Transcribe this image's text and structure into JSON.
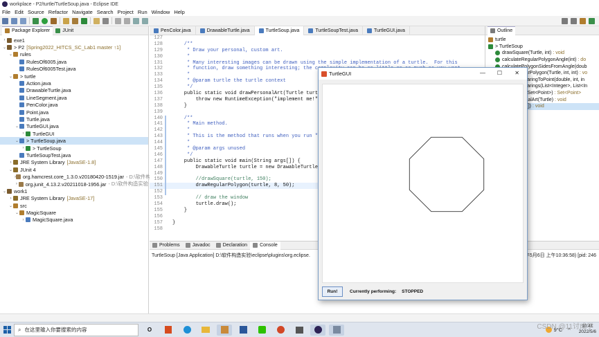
{
  "titlebar": {
    "title": "workplace - P2/turtle/TurtleSoup.java - Eclipse IDE"
  },
  "menu": [
    "File",
    "Edit",
    "Source",
    "Refactor",
    "Navigate",
    "Search",
    "Project",
    "Run",
    "Window",
    "Help"
  ],
  "explorer": {
    "tabs": [
      "Package Explorer",
      "JUnit"
    ],
    "rows": [
      {
        "indent": 0,
        "twisty": "›",
        "icon": "project-icon",
        "color": "#7a5b2e",
        "label": "exe1",
        "dec": "",
        "gray": ""
      },
      {
        "indent": 0,
        "twisty": "⌄",
        "icon": "project-icon",
        "color": "#7a5b2e",
        "label": "> P2",
        "dec": "[Spring2022_HITCS_SC_Lab1 master ↑1]",
        "gray": ""
      },
      {
        "indent": 1,
        "twisty": "⌄",
        "icon": "package-icon",
        "color": "#b07d2e",
        "label": "rules",
        "dec": "",
        "gray": ""
      },
      {
        "indent": 2,
        "twisty": "",
        "icon": "java-file-icon",
        "color": "#4a7bbd",
        "label": "RulesOf6005.java",
        "dec": "",
        "gray": ""
      },
      {
        "indent": 2,
        "twisty": "",
        "icon": "java-file-icon",
        "color": "#4a7bbd",
        "label": "RulesOf6005Test.java",
        "dec": "",
        "gray": ""
      },
      {
        "indent": 1,
        "twisty": "⌄",
        "icon": "package-icon",
        "color": "#b07d2e",
        "label": "> turtle",
        "dec": "",
        "gray": ""
      },
      {
        "indent": 2,
        "twisty": "",
        "icon": "java-file-icon",
        "color": "#4a7bbd",
        "label": "Action.java",
        "dec": "",
        "gray": ""
      },
      {
        "indent": 2,
        "twisty": "",
        "icon": "java-file-icon",
        "color": "#4a7bbd",
        "label": "DrawableTurtle.java",
        "dec": "",
        "gray": ""
      },
      {
        "indent": 2,
        "twisty": "",
        "icon": "java-file-icon",
        "color": "#4a7bbd",
        "label": "LineSegment.java",
        "dec": "",
        "gray": ""
      },
      {
        "indent": 2,
        "twisty": "",
        "icon": "java-file-icon",
        "color": "#4a7bbd",
        "label": "PenColor.java",
        "dec": "",
        "gray": ""
      },
      {
        "indent": 2,
        "twisty": "",
        "icon": "java-file-icon",
        "color": "#4a7bbd",
        "label": "Point.java",
        "dec": "",
        "gray": ""
      },
      {
        "indent": 2,
        "twisty": "",
        "icon": "java-file-icon",
        "color": "#4a7bbd",
        "label": "Turtle.java",
        "dec": "",
        "gray": ""
      },
      {
        "indent": 2,
        "twisty": "⌄",
        "icon": "java-file-icon",
        "color": "#4a7bbd",
        "label": "TurtleGUI.java",
        "dec": "",
        "gray": ""
      },
      {
        "indent": 3,
        "twisty": "›",
        "icon": "class-icon",
        "color": "#2d8a3b",
        "label": "TurtleGUI",
        "dec": "",
        "gray": ""
      },
      {
        "indent": 2,
        "twisty": "⌄",
        "icon": "java-file-icon",
        "color": "#4a7bbd",
        "label": "> TurtleSoup.java",
        "dec": "",
        "gray": "",
        "selected": true
      },
      {
        "indent": 3,
        "twisty": "›",
        "icon": "class-icon",
        "color": "#2d8a3b",
        "label": "> TurtleSoup",
        "dec": "",
        "gray": ""
      },
      {
        "indent": 2,
        "twisty": "",
        "icon": "java-file-icon",
        "color": "#4a7bbd",
        "label": "TurtleSoupTest.java",
        "dec": "",
        "gray": ""
      },
      {
        "indent": 1,
        "twisty": "›",
        "icon": "library-icon",
        "color": "#8a6d2a",
        "label": "JRE System Library",
        "dec": "[JavaSE-1.8]",
        "gray": ""
      },
      {
        "indent": 1,
        "twisty": "⌄",
        "icon": "library-icon",
        "color": "#8a6d2a",
        "label": "JUnit 4",
        "dec": "",
        "gray": ""
      },
      {
        "indent": 2,
        "twisty": "›",
        "icon": "jar-icon",
        "color": "#9a7a4a",
        "label": "org.hamcrest.core_1.3.0.v20180420-1519.jar",
        "dec": "",
        "gray": "- D:\\软件构"
      },
      {
        "indent": 2,
        "twisty": "›",
        "icon": "jar-icon",
        "color": "#9a7a4a",
        "label": "org.junit_4.13.2.v20211018-1956.jar",
        "dec": "",
        "gray": "- D:\\软件构造实验"
      },
      {
        "indent": 0,
        "twisty": "⌄",
        "icon": "project-icon",
        "color": "#7a5b2e",
        "label": "work1",
        "dec": "",
        "gray": ""
      },
      {
        "indent": 1,
        "twisty": "›",
        "icon": "library-icon",
        "color": "#8a6d2a",
        "label": "JRE System Library",
        "dec": "[JavaSE-17]",
        "gray": ""
      },
      {
        "indent": 1,
        "twisty": "⌄",
        "icon": "folder-icon",
        "color": "#b07d2e",
        "label": "src",
        "dec": "",
        "gray": ""
      },
      {
        "indent": 2,
        "twisty": "⌄",
        "icon": "package-icon",
        "color": "#b07d2e",
        "label": "MagicSquare",
        "dec": "",
        "gray": ""
      },
      {
        "indent": 3,
        "twisty": "›",
        "icon": "java-file-icon",
        "color": "#4a7bbd",
        "label": "MagicSquare.java",
        "dec": "",
        "gray": ""
      }
    ]
  },
  "editor": {
    "tabs": [
      "PenColor.java",
      "DrawableTurtle.java",
      "TurtleSoup.java",
      "TurtleSoupTest.java",
      "TurtleGUI.java"
    ],
    "active_tab": 2,
    "lines": [
      {
        "n": "127",
        "t": "",
        "c": "ct"
      },
      {
        "n": "128",
        "t": "    /**",
        "c": "cm"
      },
      {
        "n": "129",
        "t": "     * Draw your personal, custom art.",
        "c": "cm"
      },
      {
        "n": "130",
        "t": "     *",
        "c": "cm"
      },
      {
        "n": "131",
        "t": "     * Many interesting images can be drawn using the simple implementation of a turtle.  For this",
        "c": "cm"
      },
      {
        "n": "132",
        "t": "     * function, draw something interesting; the complexity can be as little or as much as you want.",
        "c": "cm"
      },
      {
        "n": "133",
        "t": "     *",
        "c": "cm"
      },
      {
        "n": "134",
        "t": "     * @param turtle the turtle context",
        "c": "cm"
      },
      {
        "n": "135",
        "t": "     */",
        "c": "cm"
      },
      {
        "n": "136",
        "t": "    public static void drawPersonalArt(Turtle turtle) {",
        "c": "ct"
      },
      {
        "n": "137",
        "t": "        throw new RuntimeException(\"implement me!\");",
        "c": "ct"
      },
      {
        "n": "138",
        "t": "    }",
        "c": "ct"
      },
      {
        "n": "139",
        "t": "",
        "c": "ct"
      },
      {
        "n": "140",
        "t": "    /**",
        "c": "cm"
      },
      {
        "n": "141",
        "t": "     * Main method.",
        "c": "cm"
      },
      {
        "n": "142",
        "t": "     *",
        "c": "cm"
      },
      {
        "n": "143",
        "t": "     * This is the method that runs when you run \"java TurtleSoup\".",
        "c": "cm"
      },
      {
        "n": "144",
        "t": "     *",
        "c": "cm"
      },
      {
        "n": "145",
        "t": "     * @param args unused",
        "c": "cm"
      },
      {
        "n": "146",
        "t": "     */",
        "c": "cm"
      },
      {
        "n": "147",
        "t": "    public static void main(String args[]) {",
        "c": "ct"
      },
      {
        "n": "148",
        "t": "        DrawableTurtle turtle = new DrawableTurtle();",
        "c": "ct"
      },
      {
        "n": "149",
        "t": "",
        "c": "ct"
      },
      {
        "n": "150",
        "t": "        //drawSquare(turtle, 150);",
        "c": "gc"
      },
      {
        "n": "151",
        "t": "        drawRegularPolygon(turtle, 8, 50);",
        "c": "ct",
        "hl": true
      },
      {
        "n": "152",
        "t": "",
        "c": "ct"
      },
      {
        "n": "153",
        "t": "        // draw the window",
        "c": "gc"
      },
      {
        "n": "154",
        "t": "        turtle.draw();",
        "c": "ct"
      },
      {
        "n": "155",
        "t": "    }",
        "c": "ct"
      },
      {
        "n": "156",
        "t": "",
        "c": "ct"
      },
      {
        "n": "157",
        "t": "}",
        "c": "ct"
      },
      {
        "n": "158",
        "t": "",
        "c": "ct"
      }
    ]
  },
  "outline": {
    "tab": "Outline",
    "rows": [
      {
        "indent": 0,
        "icon": "package-icon",
        "color": "#b07d2e",
        "label": "turtle",
        "ret": ""
      },
      {
        "indent": 0,
        "icon": "class-icon",
        "color": "#2d8a3b",
        "label": "> TurtleSoup",
        "ret": ""
      },
      {
        "indent": 1,
        "icon": "method-icon",
        "color": "#2d8a3b",
        "label": "drawSquare(Turtle, int)",
        "ret": ": void"
      },
      {
        "indent": 1,
        "icon": "method-icon",
        "color": "#2d8a3b",
        "label": "calculateRegularPolygonAngle(int)",
        "ret": ": do"
      },
      {
        "indent": 1,
        "icon": "method-icon",
        "color": "#2d8a3b",
        "label": "calculatePolygonSidesFromAngle(doub",
        "ret": ""
      },
      {
        "indent": 1,
        "icon": "method-icon",
        "color": "#2d8a3b",
        "label": "drawRegularPolygon(Turtle, int, int)",
        "ret": ": vo"
      },
      {
        "indent": 1,
        "icon": "method-icon",
        "color": "#2d8a3b",
        "label": "calculateBearingToPoint(double, int, in",
        "ret": ""
      },
      {
        "indent": 1,
        "icon": "method-icon",
        "color": "#2d8a3b",
        "label": "calculateBearings(List<Integer>, List<In",
        "ret": ""
      },
      {
        "indent": 1,
        "icon": "method-icon",
        "color": "#2d8a3b",
        "label": "convexHull(Set<Point>)",
        "ret": ": Set<Point>"
      },
      {
        "indent": 1,
        "icon": "method-icon",
        "color": "#2d8a3b",
        "label": "drawPersonalArt(Turtle)",
        "ret": ": void"
      },
      {
        "indent": 1,
        "icon": "method-icon",
        "color": "#2d8a3b",
        "label": "main(String[])",
        "ret": ": void",
        "selected": true
      }
    ]
  },
  "console": {
    "tabs": [
      "Problems",
      "Javadoc",
      "Declaration",
      "Console"
    ],
    "active_tab": 3,
    "line": "TurtleSoup [Java Application] D:\\软件构造实验\\eclipse\\plugins\\org.eclipse.",
    "line_end": "年5月6日 上午10:36:58) [pid: 246"
  },
  "turtlegui": {
    "title": "TurtleGUI",
    "run_label": "Run!",
    "performing_label": "Currently performing:",
    "status": "STOPPED",
    "polygon_sides": 8,
    "side_length": 50
  },
  "taskbar": {
    "search_placeholder": "在这里输入你要搜索的内容",
    "weather": "9°C",
    "time": "10:41",
    "date": "2022/5/6",
    "watermark": "CSDN @11讨成学"
  }
}
